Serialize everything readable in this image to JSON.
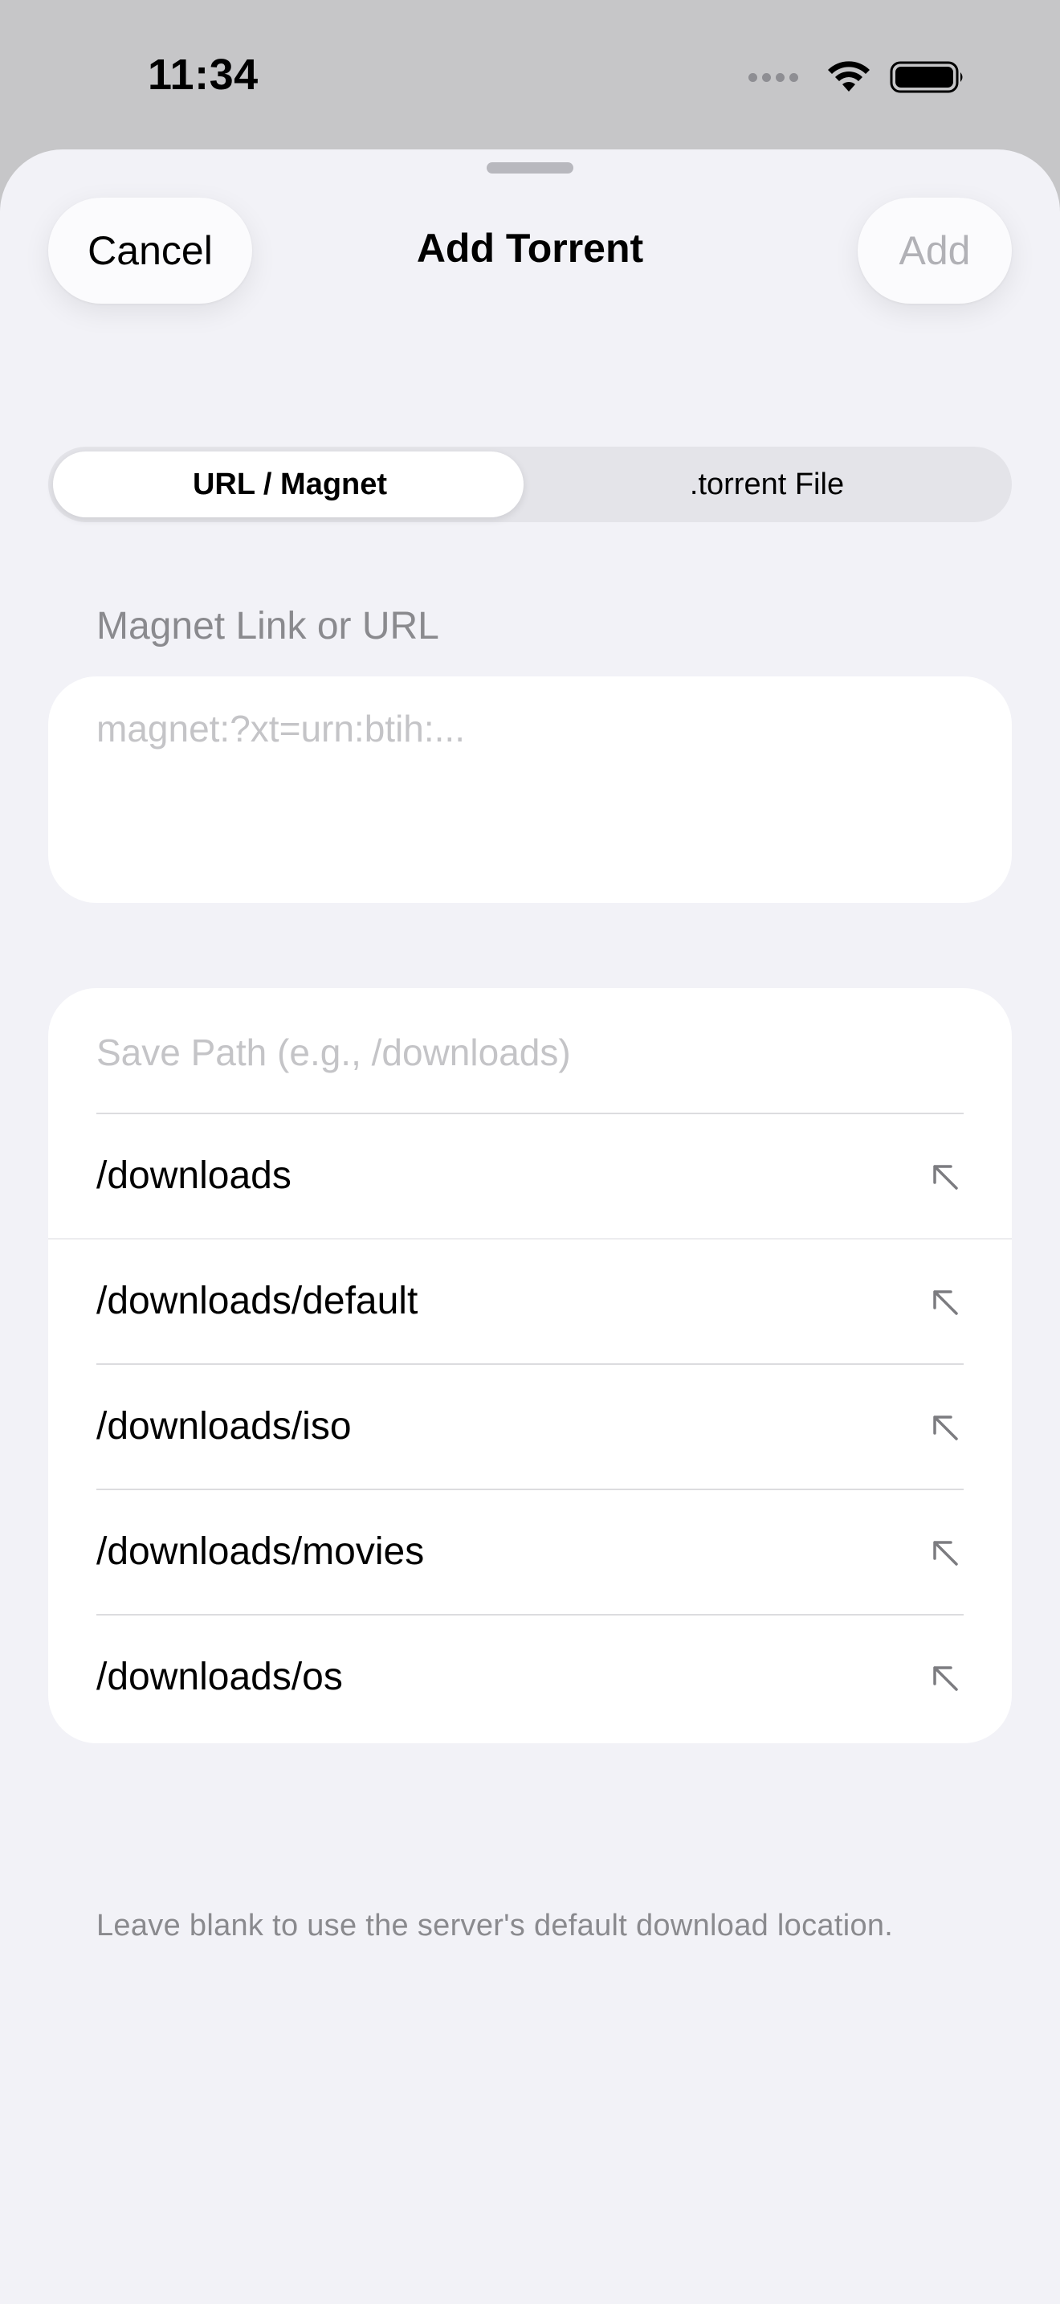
{
  "status_bar": {
    "time": "11:34"
  },
  "navigation": {
    "title": "Add Torrent",
    "cancel_label": "Cancel",
    "add_label": "Add"
  },
  "segmented_control": {
    "options": [
      "URL / Magnet",
      ".torrent File"
    ],
    "selected": "URL / Magnet"
  },
  "magnet_section": {
    "header": "Magnet Link or URL",
    "placeholder": "magnet:?xt=urn:btih:...",
    "value": ""
  },
  "save_path": {
    "placeholder": "Save Path (e.g., /downloads)",
    "value": "",
    "suggestions": [
      "/downloads",
      "/downloads/default",
      "/downloads/iso",
      "/downloads/movies",
      "/downloads/os"
    ],
    "footer": "Leave blank to use the server's default download location."
  },
  "colors": {
    "sheet_background": "#f2f2f7",
    "disabled_text": "#b1b1b6",
    "secondary_text": "#8a8a8e",
    "placeholder_text": "#c4c4c7"
  }
}
